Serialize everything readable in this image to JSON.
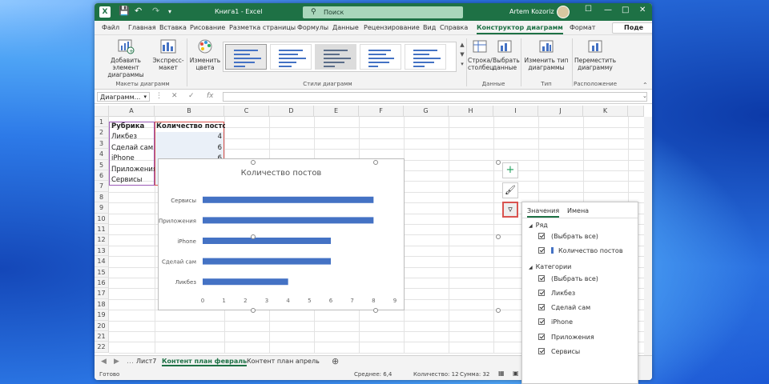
{
  "titlebar": {
    "doc_title": "Книга1  -  Excel",
    "search_placeholder": "Поиск",
    "user_name": "Artem Kozoriz"
  },
  "tabs": [
    "Файл",
    "Главная",
    "Вставка",
    "Рисование",
    "Разметка страницы",
    "Формулы",
    "Данные",
    "Рецензирование",
    "Вид",
    "Справка",
    "Конструктор диаграмм",
    "Формат"
  ],
  "active_tab": "Конструктор диаграмм",
  "share_label": "Поде",
  "ribbon": {
    "add_element": "Добавить элемент\nдиаграммы",
    "express_layout": "Экспресс-\nмакет",
    "change_colors": "Изменить\nцвета",
    "row_col": "Строка/\nстолбец",
    "select_data": "Выбрать\nданные",
    "change_type": "Изменить тип\nдиаграммы",
    "move_chart": "Переместить\nдиаграмму",
    "group_layouts": "Макеты диаграмм",
    "group_styles": "Стили диаграмм",
    "group_data": "Данные",
    "group_type": "Тип",
    "group_location": "Расположение"
  },
  "formula": {
    "namebox": "Диаграмм...",
    "fx": "fx"
  },
  "columns": [
    "A",
    "B",
    "C",
    "D",
    "E",
    "F",
    "G",
    "H",
    "I",
    "J",
    "K"
  ],
  "rows": [
    "1",
    "2",
    "3",
    "4",
    "5",
    "6",
    "7",
    "8",
    "9",
    "10",
    "11",
    "12",
    "13",
    "14",
    "15",
    "16",
    "17",
    "18",
    "19",
    "20",
    "21",
    "22"
  ],
  "table": {
    "header": [
      "Рубрика",
      "Количество постов"
    ],
    "rows": [
      [
        "Ликбез",
        "4"
      ],
      [
        "Сделай сам",
        "6"
      ],
      [
        "iPhone",
        "6"
      ],
      [
        "Приложения",
        "8"
      ],
      [
        "Сервисы",
        "8"
      ]
    ]
  },
  "chart_data": {
    "type": "bar",
    "title": "Количество постов",
    "categories": [
      "Ликбез",
      "Сделай сам",
      "iPhone",
      "Приложения",
      "Сервисы"
    ],
    "values": [
      4,
      6,
      6,
      8,
      8
    ],
    "xlim": [
      0,
      9
    ],
    "xticks": [
      "0",
      "1",
      "2",
      "3",
      "4",
      "5",
      "6",
      "7",
      "8",
      "9"
    ],
    "orientation": "horizontal",
    "bar_color": "#4472c4"
  },
  "filter_pane": {
    "tab_values": "Значения",
    "tab_names": "Имена",
    "series_heading": "Ряд",
    "series_items": [
      "(Выбрать все)",
      "Количество постов"
    ],
    "categories_heading": "Категории",
    "category_items": [
      "(Выбрать все)",
      "Ликбез",
      "Сделай сам",
      "iPhone",
      "Приложения",
      "Сервисы"
    ]
  },
  "sheets": [
    "Лист7",
    "Контент план февраль",
    "Контент план апрель"
  ],
  "active_sheet": "Контент план февраль",
  "status": {
    "ready": "Готово",
    "average": "Среднее: 6,4",
    "count": "Количество: 12",
    "sum": "Сумма: 32"
  }
}
